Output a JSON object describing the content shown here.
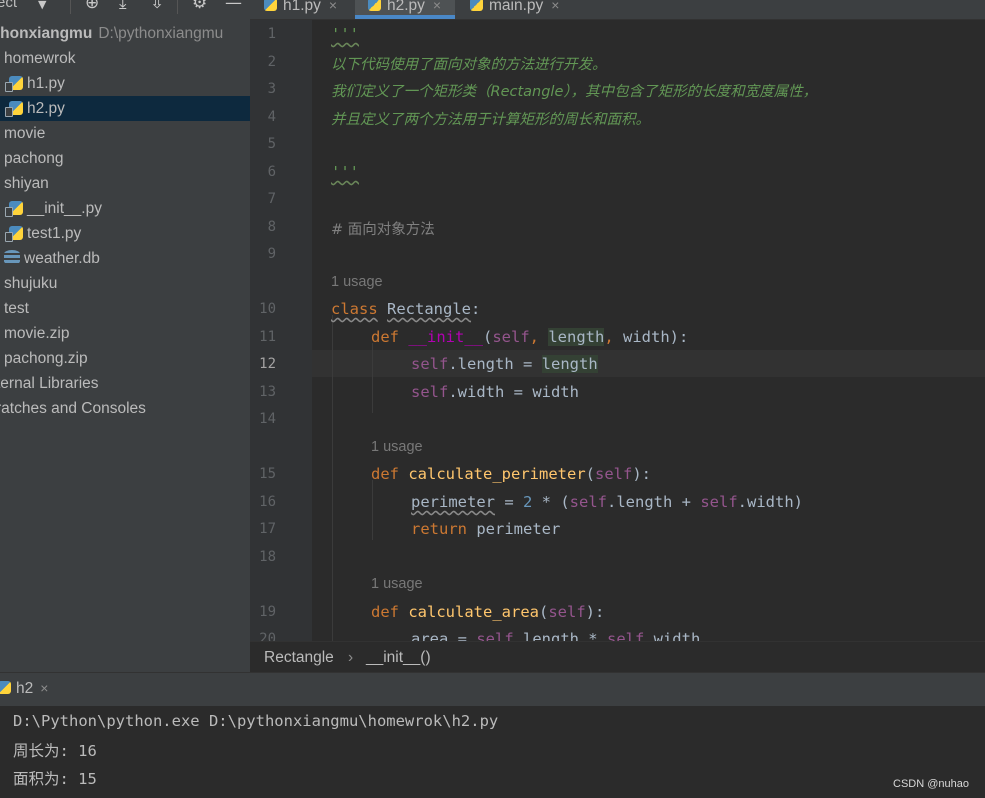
{
  "project_panel": {
    "title": "ect",
    "dropdown_icon": "▼",
    "toolbar_icons": {
      "target": "⊕",
      "collapse": "⤓",
      "expand": "⇳",
      "settings": "⚙",
      "hide": "—"
    },
    "root": {
      "name": "thonxiangmu",
      "path": "D:\\pythonxiangmu"
    },
    "items": [
      {
        "label": "homewrok"
      },
      {
        "label": "h1.py"
      },
      {
        "label": "h2.py"
      },
      {
        "label": "movie"
      },
      {
        "label": "pachong"
      },
      {
        "label": "shiyan"
      },
      {
        "label": "__init__.py"
      },
      {
        "label": "test1.py"
      },
      {
        "label": "weather.db"
      },
      {
        "label": "shujuku"
      },
      {
        "label": "test"
      },
      {
        "label": "movie.zip"
      },
      {
        "label": "pachong.zip"
      },
      {
        "label": "ternal Libraries"
      },
      {
        "label": "ratches and Consoles"
      }
    ]
  },
  "tabs": [
    {
      "label": "h1.py",
      "close": "×"
    },
    {
      "label": "h2.py",
      "close": "×"
    },
    {
      "label": "main.py",
      "close": "×"
    }
  ],
  "editor": {
    "line_numbers": [
      "1",
      "2",
      "3",
      "4",
      "5",
      "6",
      "7",
      "8",
      "9",
      "10",
      "11",
      "12",
      "13",
      "14",
      "15",
      "16",
      "17",
      "18",
      "19",
      "20"
    ],
    "docstring_quote": "'''",
    "doc_line_2": "以下代码使用了面向对象的方法进行开发。",
    "doc_line_3": "我们定义了一个矩形类（Rectangle），其中包含了矩形的长度和宽度属性，",
    "doc_line_4": "并且定义了两个方法用于计算矩形的周长和面积。",
    "comment_line_8": "# 面向对象方法",
    "usage_label": "1 usage",
    "kw_class": "class",
    "class_name": "Rectangle",
    "colon": ":",
    "kw_def": "def",
    "init_name": "__init__",
    "init_params_open": "(",
    "self": "self",
    "comma_sp": ", ",
    "param_length": "length",
    "param_width_close": "width):",
    "attr_length_assign": ".length = ",
    "attr_width_assign": ".width = width",
    "perimeter_fn": "calculate_perimeter",
    "paren_self_close": "):",
    "open_paren": "(",
    "perimeter_var": "perimeter",
    "perimeter_expr_a": " = ",
    "num_2": "2",
    "perimeter_expr_b": " * (",
    "dot_length_plus": ".length + ",
    "dot_width_close": ".width)",
    "kw_return": "return",
    "return_val": " perimeter",
    "area_fn": "calculate_area",
    "area_line": "area = ",
    "area_mid": ".length * ",
    "area_end": ".width"
  },
  "breadcrumb": [
    "Rectangle",
    "›",
    "__init__()"
  ],
  "run": {
    "tab_label": "h2",
    "close": "×",
    "output": [
      "D:\\Python\\python.exe D:\\pythonxiangmu\\homewrok\\h2.py",
      "周长为: 16",
      "面积为: 15"
    ]
  },
  "watermark": "CSDN @nuhao"
}
